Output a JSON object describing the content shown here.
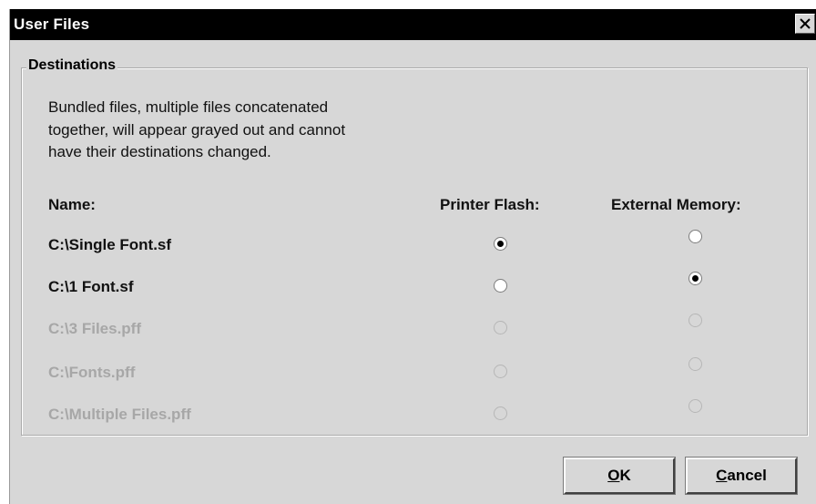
{
  "window": {
    "title": "User Files",
    "close_icon": "close-icon"
  },
  "destinations": {
    "legend": "Destinations",
    "description_lines": [
      "Bundled files, multiple files concatenated",
      "together, will appear grayed out and cannot",
      "have their destinations changed."
    ],
    "columns": {
      "name": "Name:",
      "printer_flash": "Printer Flash:",
      "external_memory": "External Memory:"
    },
    "files": [
      {
        "name": "C:\\Single Font.sf",
        "enabled": true,
        "destination": "printer_flash"
      },
      {
        "name": "C:\\1 Font.sf",
        "enabled": true,
        "destination": "external_memory"
      },
      {
        "name": "C:\\3 Files.pff",
        "enabled": false,
        "destination": null
      },
      {
        "name": "C:\\Fonts.pff",
        "enabled": false,
        "destination": null
      },
      {
        "name": "C:\\Multiple Files.pff",
        "enabled": false,
        "destination": null
      }
    ]
  },
  "buttons": {
    "ok": {
      "mnemonic": "O",
      "rest": "K"
    },
    "cancel": {
      "mnemonic": "C",
      "rest": "ancel"
    }
  },
  "colors": {
    "titlebar": "#000000",
    "dialog_background": "#d7d7d7",
    "disabled_text": "#a7a7a7"
  }
}
